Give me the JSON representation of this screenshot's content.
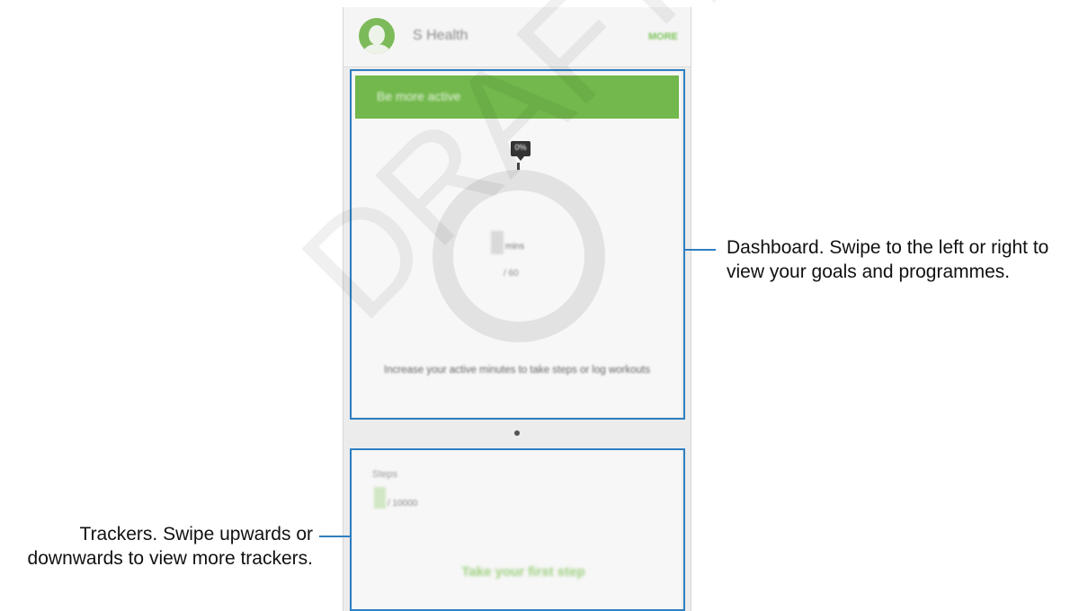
{
  "app": {
    "title": "S Health",
    "more_label": "MORE",
    "accent_color": "#72b84c"
  },
  "dashboard": {
    "goal_title": "Be more active",
    "progress_tag": "0%",
    "unit": "mins",
    "goal": "/ 60",
    "tip": "Increase your active minutes to take steps or log workouts"
  },
  "tracker": {
    "label": "Steps",
    "goal": "/ 10000",
    "cta": "Take your first step"
  },
  "annotations": {
    "dashboard": "Dashboard. Swipe to the left or right to view your goals and programmes.",
    "trackers": "Trackers. Swipe upwards or downwards to view more trackers."
  },
  "watermark": "DRAFT, Not Final",
  "colors": {
    "callout_blue": "#2f7fc1"
  }
}
